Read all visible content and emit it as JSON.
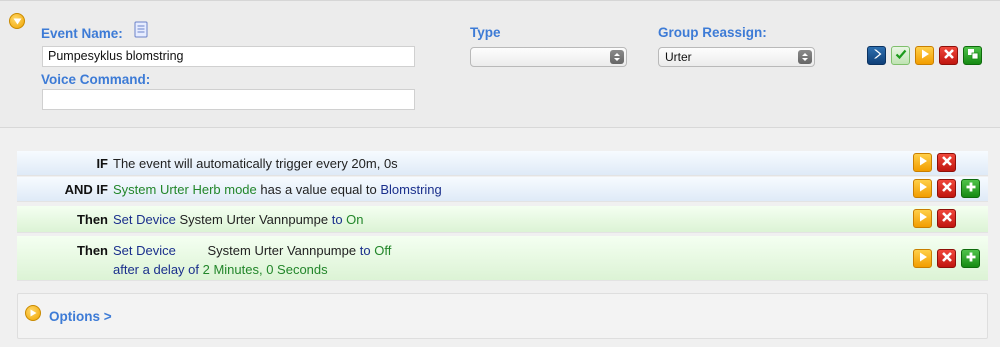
{
  "event": {
    "name_label": "Event Name:",
    "name_value": "Pumpesyklus blomstring",
    "voice_label": "Voice Command:",
    "voice_value": ""
  },
  "type_field": {
    "label": "Type",
    "value": ""
  },
  "group_field": {
    "label": "Group Reassign:",
    "value": "Urter"
  },
  "toolbar_icons": [
    "next-icon",
    "check-icon",
    "play-icon",
    "delete-icon",
    "copy-icon"
  ],
  "rules": [
    {
      "keyword": "IF",
      "segments": [
        {
          "text": "The event will automatically trigger every 20m, 0s",
          "color": "black"
        }
      ],
      "actions": [
        "play",
        "delete"
      ]
    },
    {
      "keyword": "AND IF",
      "segments": [
        {
          "text": "System Urter Herb mode",
          "color": "green"
        },
        {
          "text": " has a value equal to ",
          "color": "navy"
        },
        {
          "text": "Blomstring",
          "color": "navy"
        }
      ],
      "actions": [
        "play",
        "delete",
        "add"
      ]
    },
    {
      "keyword": "Then",
      "segments": [
        {
          "text": "Set Device",
          "color": "navy"
        },
        {
          "text": " System Urter Vannpumpe ",
          "color": "black"
        },
        {
          "text": "to",
          "color": "navy"
        },
        {
          "text": " On",
          "color": "green"
        }
      ],
      "actions": [
        "play",
        "delete"
      ]
    },
    {
      "keyword": "Then",
      "line1": {
        "set": "Set Device",
        "device": "System Urter Vannpumpe",
        "to": "to",
        "value": "Off"
      },
      "line2": {
        "prefix": "after a delay of",
        "delay": "2 Minutes, 0 Seconds"
      },
      "actions": [
        "play",
        "delete",
        "add"
      ]
    }
  ],
  "options": {
    "label": "Options >"
  },
  "colors": {
    "label_blue": "#3d7bd6",
    "green_text": "#22862a",
    "navy_text": "#1a2f8c"
  }
}
